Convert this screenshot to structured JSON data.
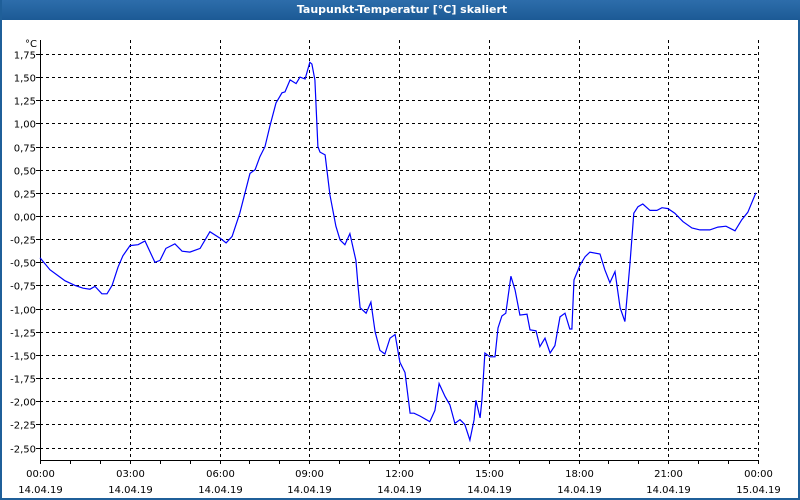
{
  "window": {
    "title": "Taupunkt-Temperatur [°C] skaliert"
  },
  "colors": {
    "title_bar": "#1f5f99",
    "line": "#0000ff",
    "grid": "#000000"
  },
  "chart_data": {
    "type": "line",
    "title": "Taupunkt-Temperatur [°C] skaliert",
    "ylabel": "°C",
    "xlabel": "",
    "ylim": [
      -2.6,
      1.85
    ],
    "xlim_hours": [
      0,
      24
    ],
    "grid": true,
    "y_ticks": [
      {
        "value": 1.75,
        "label": "1,75"
      },
      {
        "value": 1.5,
        "label": "1,50"
      },
      {
        "value": 1.25,
        "label": "1,25"
      },
      {
        "value": 1.0,
        "label": "1,00"
      },
      {
        "value": 0.75,
        "label": "0,75"
      },
      {
        "value": 0.5,
        "label": "0,50"
      },
      {
        "value": 0.25,
        "label": "0,25"
      },
      {
        "value": 0.0,
        "label": "0,00"
      },
      {
        "value": -0.25,
        "label": "-0,25"
      },
      {
        "value": -0.5,
        "label": "-0,50"
      },
      {
        "value": -0.75,
        "label": "-0,75"
      },
      {
        "value": -1.0,
        "label": "-1,00"
      },
      {
        "value": -1.25,
        "label": "-1,25"
      },
      {
        "value": -1.5,
        "label": "-1,50"
      },
      {
        "value": -1.75,
        "label": "-1,75"
      },
      {
        "value": -2.0,
        "label": "-2,00"
      },
      {
        "value": -2.25,
        "label": "-2,25"
      },
      {
        "value": -2.5,
        "label": "-2,50"
      }
    ],
    "x_ticks": [
      {
        "hour": 0,
        "time": "00:00",
        "date": "14.04.19"
      },
      {
        "hour": 3,
        "time": "03:00",
        "date": "14.04.19"
      },
      {
        "hour": 6,
        "time": "06:00",
        "date": "14.04.19"
      },
      {
        "hour": 9,
        "time": "09:00",
        "date": "14.04.19"
      },
      {
        "hour": 12,
        "time": "12:00",
        "date": "14.04.19"
      },
      {
        "hour": 15,
        "time": "15:00",
        "date": "14.04.19"
      },
      {
        "hour": 18,
        "time": "18:00",
        "date": "14.04.19"
      },
      {
        "hour": 21,
        "time": "21:00",
        "date": "14.04.19"
      },
      {
        "hour": 24,
        "time": "00:00",
        "date": "15.04.19"
      }
    ],
    "series": [
      {
        "name": "Taupunkt-Temperatur",
        "points": [
          [
            0.0,
            -0.45
          ],
          [
            0.33,
            -0.58
          ],
          [
            0.67,
            -0.66
          ],
          [
            0.84,
            -0.7
          ],
          [
            1.17,
            -0.75
          ],
          [
            1.44,
            -0.78
          ],
          [
            1.67,
            -0.79
          ],
          [
            1.84,
            -0.76
          ],
          [
            2.07,
            -0.84
          ],
          [
            2.24,
            -0.84
          ],
          [
            2.41,
            -0.75
          ],
          [
            2.61,
            -0.55
          ],
          [
            2.77,
            -0.43
          ],
          [
            3.01,
            -0.32
          ],
          [
            3.28,
            -0.31
          ],
          [
            3.51,
            -0.27
          ],
          [
            3.84,
            -0.5
          ],
          [
            4.01,
            -0.48
          ],
          [
            4.21,
            -0.35
          ],
          [
            4.51,
            -0.3
          ],
          [
            4.75,
            -0.38
          ],
          [
            5.01,
            -0.39
          ],
          [
            5.35,
            -0.35
          ],
          [
            5.68,
            -0.17
          ],
          [
            6.02,
            -0.24
          ],
          [
            6.22,
            -0.29
          ],
          [
            6.42,
            -0.22
          ],
          [
            6.68,
            0.03
          ],
          [
            7.02,
            0.46
          ],
          [
            7.19,
            0.5
          ],
          [
            7.35,
            0.64
          ],
          [
            7.52,
            0.75
          ],
          [
            7.69,
            0.98
          ],
          [
            7.89,
            1.22
          ],
          [
            8.09,
            1.33
          ],
          [
            8.19,
            1.34
          ],
          [
            8.36,
            1.47
          ],
          [
            8.56,
            1.43
          ],
          [
            8.69,
            1.5
          ],
          [
            8.86,
            1.48
          ],
          [
            9.02,
            1.66
          ],
          [
            9.09,
            1.64
          ],
          [
            9.19,
            1.47
          ],
          [
            9.29,
            0.75
          ],
          [
            9.36,
            0.69
          ],
          [
            9.53,
            0.66
          ],
          [
            9.69,
            0.23
          ],
          [
            9.89,
            -0.11
          ],
          [
            10.03,
            -0.26
          ],
          [
            10.19,
            -0.31
          ],
          [
            10.36,
            -0.19
          ],
          [
            10.56,
            -0.48
          ],
          [
            10.63,
            -0.75
          ],
          [
            10.7,
            -0.99
          ],
          [
            10.9,
            -1.05
          ],
          [
            11.06,
            -0.93
          ],
          [
            11.2,
            -1.25
          ],
          [
            11.36,
            -1.45
          ],
          [
            11.53,
            -1.49
          ],
          [
            11.7,
            -1.32
          ],
          [
            11.87,
            -1.28
          ],
          [
            12.03,
            -1.58
          ],
          [
            12.2,
            -1.69
          ],
          [
            12.37,
            -2.13
          ],
          [
            12.5,
            -2.13
          ],
          [
            12.7,
            -2.16
          ],
          [
            13.03,
            -2.22
          ],
          [
            13.2,
            -2.1
          ],
          [
            13.34,
            -1.81
          ],
          [
            13.54,
            -1.95
          ],
          [
            13.7,
            -2.04
          ],
          [
            13.87,
            -2.24
          ],
          [
            14.04,
            -2.2
          ],
          [
            14.2,
            -2.25
          ],
          [
            14.37,
            -2.42
          ],
          [
            14.51,
            -2.2
          ],
          [
            14.57,
            -1.99
          ],
          [
            14.71,
            -2.18
          ],
          [
            14.77,
            -1.99
          ],
          [
            14.87,
            -1.48
          ],
          [
            15.04,
            -1.52
          ],
          [
            15.21,
            -1.52
          ],
          [
            15.31,
            -1.21
          ],
          [
            15.44,
            -1.08
          ],
          [
            15.57,
            -1.05
          ],
          [
            15.74,
            -0.65
          ],
          [
            15.88,
            -0.8
          ],
          [
            16.04,
            -1.07
          ],
          [
            16.28,
            -1.06
          ],
          [
            16.38,
            -1.23
          ],
          [
            16.58,
            -1.24
          ],
          [
            16.71,
            -1.41
          ],
          [
            16.88,
            -1.32
          ],
          [
            17.05,
            -1.48
          ],
          [
            17.21,
            -1.4
          ],
          [
            17.38,
            -1.09
          ],
          [
            17.55,
            -1.05
          ],
          [
            17.71,
            -1.22
          ],
          [
            17.78,
            -1.22
          ],
          [
            17.85,
            -0.69
          ],
          [
            18.05,
            -0.53
          ],
          [
            18.22,
            -0.44
          ],
          [
            18.38,
            -0.39
          ],
          [
            18.72,
            -0.41
          ],
          [
            18.88,
            -0.58
          ],
          [
            19.05,
            -0.72
          ],
          [
            19.22,
            -0.6
          ],
          [
            19.39,
            -0.99
          ],
          [
            19.55,
            -1.14
          ],
          [
            19.72,
            -0.51
          ],
          [
            19.85,
            0.03
          ],
          [
            19.99,
            0.1
          ],
          [
            20.15,
            0.13
          ],
          [
            20.39,
            0.06
          ],
          [
            20.62,
            0.06
          ],
          [
            20.79,
            0.09
          ],
          [
            20.99,
            0.08
          ],
          [
            21.22,
            0.03
          ],
          [
            21.49,
            -0.06
          ],
          [
            21.79,
            -0.13
          ],
          [
            22.06,
            -0.15
          ],
          [
            22.39,
            -0.15
          ],
          [
            22.66,
            -0.12
          ],
          [
            22.93,
            -0.11
          ],
          [
            23.23,
            -0.16
          ],
          [
            23.46,
            -0.04
          ],
          [
            23.66,
            0.04
          ],
          [
            23.93,
            0.25
          ]
        ]
      }
    ]
  }
}
